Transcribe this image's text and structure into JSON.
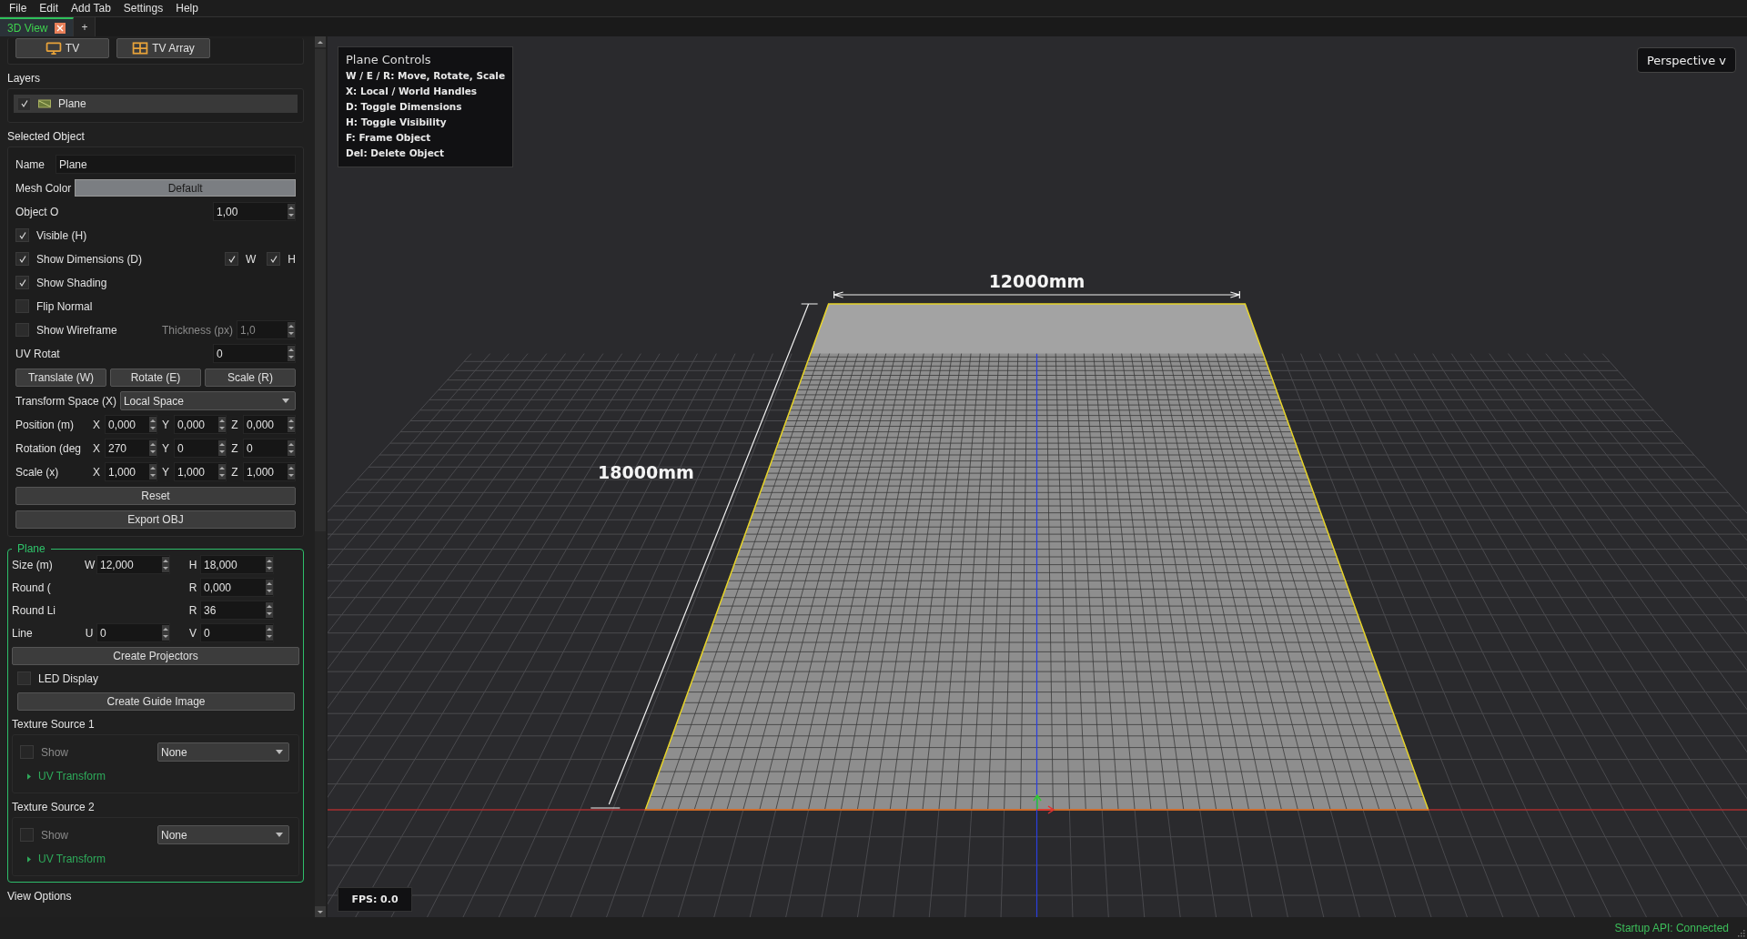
{
  "menu": [
    "File",
    "Edit",
    "Add Tab",
    "Settings",
    "Help"
  ],
  "tabs": [
    {
      "label": "3D View",
      "selected": true,
      "closable": true
    },
    {
      "label": "+",
      "selected": false,
      "closable": false
    }
  ],
  "toolbox": [
    {
      "label": "TV",
      "kind": "tv"
    },
    {
      "label": "TV Array",
      "kind": "array"
    }
  ],
  "layers": {
    "title": "Layers",
    "items": [
      {
        "label": "Plane",
        "checked": true,
        "selected": true
      }
    ]
  },
  "selected_object": {
    "title": "Selected Object",
    "rows": [
      {
        "kind": "text",
        "label": "Name",
        "value": "Plane"
      },
      {
        "kind": "color",
        "label": "Mesh Color",
        "button": "Default"
      },
      {
        "kind": "spin",
        "label": "Object O",
        "value": "1,00"
      },
      {
        "kind": "check",
        "label": "Visible (H)",
        "checked": true
      },
      {
        "kind": "check",
        "label": "Show Dimensions (D)",
        "checked": true,
        "extras": [
          {
            "label": "W",
            "checked": true
          },
          {
            "label": "H",
            "checked": true
          }
        ]
      },
      {
        "kind": "check",
        "label": "Show Shading",
        "checked": true
      },
      {
        "kind": "check",
        "label": "Flip Normal",
        "checked": false
      },
      {
        "kind": "check_spin",
        "label": "Show Wireframe",
        "checked": false,
        "sub_label": "Thickness (px)",
        "value": "1,0",
        "disabled": true
      },
      {
        "kind": "spin",
        "label": "UV Rotat",
        "value": "0"
      },
      {
        "kind": "buttons",
        "buttons": [
          "Translate (W)",
          "Rotate (E)",
          "Scale (R)"
        ]
      },
      {
        "kind": "select",
        "label": "Transform Space (X)",
        "value": "Local Space"
      },
      {
        "kind": "xyz",
        "label": "Position (m)",
        "fields": [
          {
            "axis": "X",
            "value": "0,000"
          },
          {
            "axis": "Y",
            "value": "0,000"
          },
          {
            "axis": "Z",
            "value": "0,000"
          }
        ]
      },
      {
        "kind": "xyz",
        "label": "Rotation (deg",
        "fields": [
          {
            "axis": "X",
            "value": "270"
          },
          {
            "axis": "Y",
            "value": "0"
          },
          {
            "axis": "Z",
            "value": "0"
          }
        ]
      },
      {
        "kind": "xyz",
        "label": "Scale (x)",
        "fields": [
          {
            "axis": "X",
            "value": "1,000"
          },
          {
            "axis": "Y",
            "value": "1,000"
          },
          {
            "axis": "Z",
            "value": "1,000"
          }
        ]
      },
      {
        "kind": "button",
        "label": "Reset"
      },
      {
        "kind": "button",
        "label": "Export OBJ"
      }
    ]
  },
  "plane": {
    "title": "Plane",
    "rows": [
      {
        "kind": "pair",
        "label": "Size (m)",
        "left": {
          "axis": "W",
          "value": "12,000"
        },
        "right": {
          "axis": "H",
          "value": "18,000"
        }
      },
      {
        "kind": "pair",
        "label": "Round (",
        "right": {
          "axis": "R",
          "value": "0,000"
        }
      },
      {
        "kind": "pair",
        "label": "Round Li",
        "right": {
          "axis": "R",
          "value": "36"
        }
      },
      {
        "kind": "pair",
        "label": "Line",
        "left": {
          "axis": "U",
          "value": "0"
        },
        "right": {
          "axis": "V",
          "value": "0"
        }
      },
      {
        "kind": "button",
        "label": "Create Projectors"
      },
      {
        "kind": "check",
        "label": "LED Display",
        "checked": false
      },
      {
        "kind": "sub_button",
        "label": "Create Guide Image"
      }
    ],
    "texture_sources": [
      {
        "title": "Texture Source 1",
        "show": {
          "label": "Show",
          "checked": false,
          "disabled": true
        },
        "source": "None",
        "expander": {
          "label": "UV Transform",
          "expanded": false
        }
      },
      {
        "title": "Texture Source 2",
        "show": {
          "label": "Show",
          "checked": false,
          "disabled": true
        },
        "source": "None",
        "expander": {
          "label": "UV Transform",
          "expanded": false
        }
      }
    ]
  },
  "next_section": "View Options",
  "viewport": {
    "overlay": {
      "title": "Plane Controls",
      "lines": [
        "W / E / R: Move, Rotate, Scale",
        "X: Local / World Handles",
        "D: Toggle Dimensions",
        "H: Toggle Visibility",
        "F: Frame Object",
        "Del: Delete Object"
      ]
    },
    "camera": "Perspective v",
    "fps": "FPS: 0.0",
    "dimensions": {
      "width": "12000mm",
      "height": "18000mm"
    }
  },
  "status": "Startup API: Connected"
}
